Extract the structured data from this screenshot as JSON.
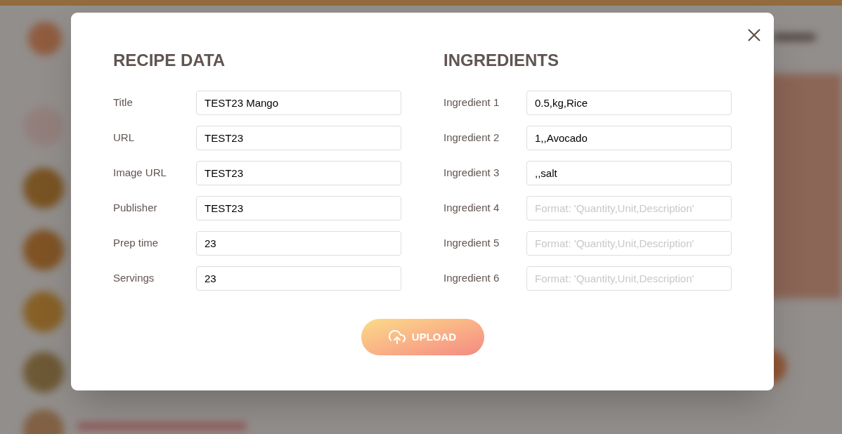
{
  "sections": [
    {
      "heading": "RECIPE DATA",
      "fields": [
        {
          "label": "Title",
          "value": "TEST23 Mango"
        },
        {
          "label": "URL",
          "value": "TEST23"
        },
        {
          "label": "Image URL",
          "value": "TEST23"
        },
        {
          "label": "Publisher",
          "value": "TEST23"
        },
        {
          "label": "Prep time",
          "value": "23"
        },
        {
          "label": "Servings",
          "value": "23"
        }
      ]
    },
    {
      "heading": "INGREDIENTS",
      "fields": [
        {
          "label": "Ingredient 1",
          "value": "0.5,kg,Rice"
        },
        {
          "label": "Ingredient 2",
          "value": "1,,Avocado"
        },
        {
          "label": "Ingredient 3",
          "value": ",,salt"
        },
        {
          "label": "Ingredient 4",
          "placeholder": "Format: 'Quantity,Unit,Description'"
        },
        {
          "label": "Ingredient 5",
          "placeholder": "Format: 'Quantity,Unit,Description'"
        },
        {
          "label": "Ingredient 6",
          "placeholder": "Format: 'Quantity,Unit,Description'"
        }
      ]
    }
  ],
  "upload_button": {
    "label": "UPLOAD"
  }
}
